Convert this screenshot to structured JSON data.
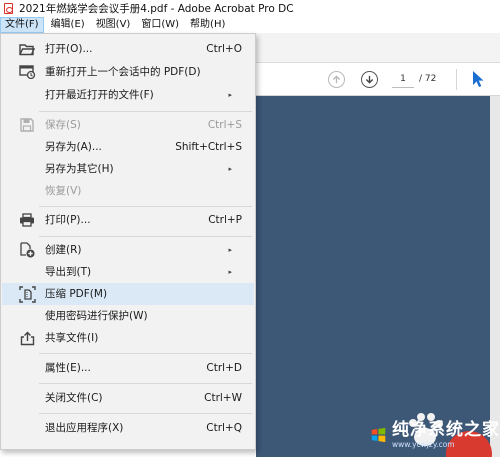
{
  "window": {
    "title": "2021年燃娆学会会议手册4.pdf - Adobe Acrobat Pro DC"
  },
  "menubar": {
    "items": [
      {
        "label": "文件(F)"
      },
      {
        "label": "编辑(E)"
      },
      {
        "label": "视图(V)"
      },
      {
        "label": "窗口(W)"
      },
      {
        "label": "帮助(H)"
      }
    ]
  },
  "toolbar": {
    "current_page": "1",
    "total_pages": "/ 72"
  },
  "file_menu": {
    "items": [
      {
        "label": "打开(O)...",
        "shortcut": "Ctrl+O",
        "icon": "folder-open-icon"
      },
      {
        "label": "重新打开上一个会话中的 PDF(D)",
        "shortcut": "",
        "icon": "reopen-session-icon"
      },
      {
        "label": "打开最近打开的文件(F)",
        "shortcut": "",
        "submenu": true
      },
      {
        "label": "保存(S)",
        "shortcut": "Ctrl+S",
        "icon": "save-icon",
        "disabled": true
      },
      {
        "label": "另存为(A)...",
        "shortcut": "Shift+Ctrl+S"
      },
      {
        "label": "另存为其它(H)",
        "shortcut": "",
        "submenu": true
      },
      {
        "label": "恢复(V)",
        "shortcut": "",
        "disabled": true
      },
      {
        "label": "打印(P)...",
        "shortcut": "Ctrl+P",
        "icon": "printer-icon"
      },
      {
        "label": "创建(R)",
        "shortcut": "",
        "submenu": true,
        "icon": "create-pdf-icon"
      },
      {
        "label": "导出到(T)",
        "shortcut": "",
        "submenu": true
      },
      {
        "label": "压缩 PDF(M)",
        "shortcut": "",
        "icon": "compress-icon",
        "highlighted": true
      },
      {
        "label": "使用密码进行保护(W)",
        "shortcut": ""
      },
      {
        "label": "共享文件(I)",
        "shortcut": "",
        "icon": "share-icon"
      },
      {
        "label": "属性(E)...",
        "shortcut": "Ctrl+D"
      },
      {
        "label": "关闭文件(C)",
        "shortcut": "Ctrl+W"
      },
      {
        "label": "退出应用程序(X)",
        "shortcut": "Ctrl+Q"
      }
    ]
  },
  "submenu_arrow": "▸",
  "watermark": {
    "main": "纯净系统之家",
    "sub": "www.ycwjzy.com"
  },
  "colors": {
    "document_background": "#3d5777",
    "menu_background": "#f2f2f2",
    "highlight": "#dbe9f6",
    "active_menu": "#cce4f7",
    "acrobat_red": "#d9302a"
  }
}
